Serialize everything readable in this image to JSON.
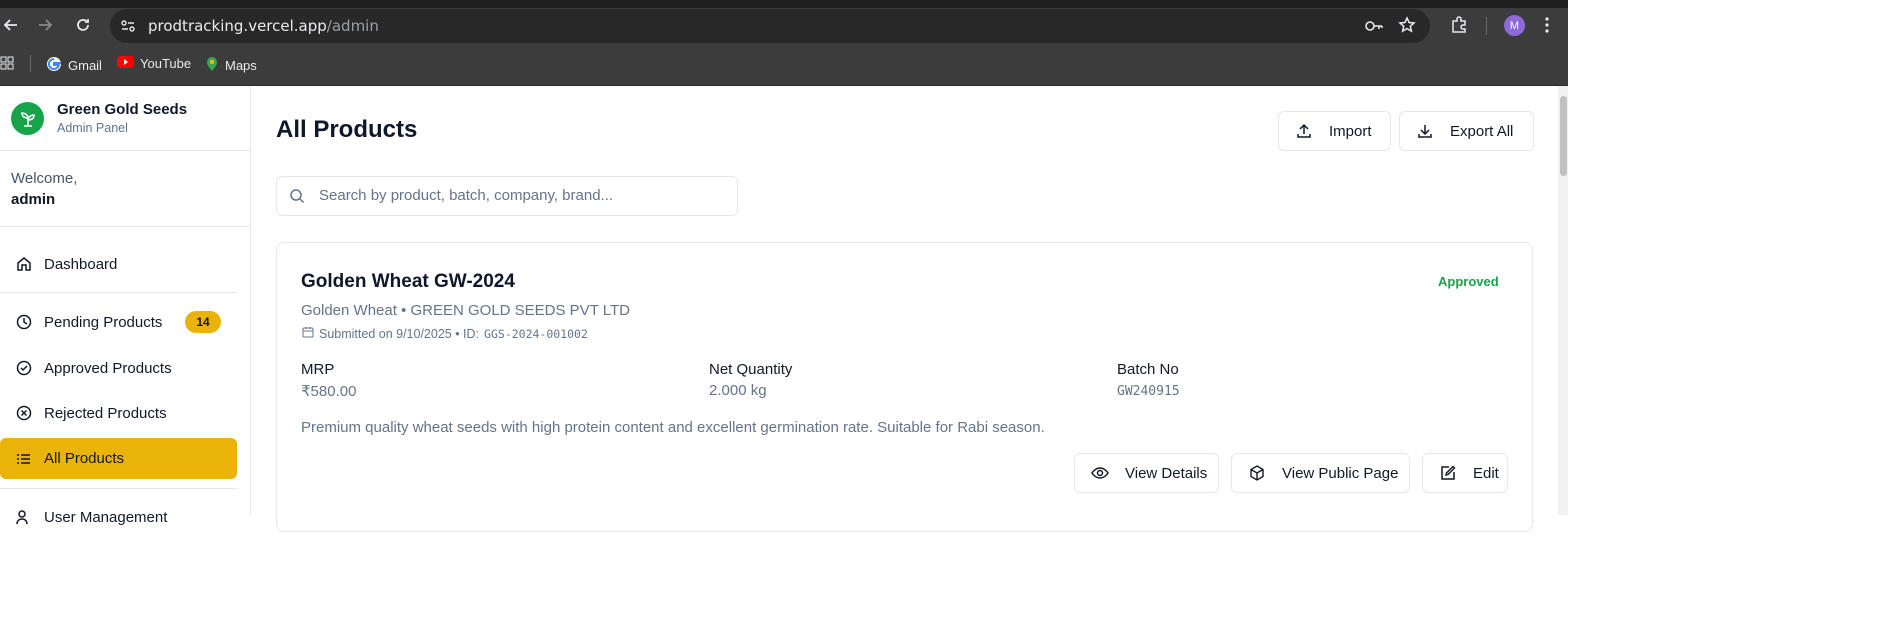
{
  "browser": {
    "url_host": "prodtracking.vercel.app",
    "url_path": "/admin",
    "profile_initial": "M",
    "bookmarks": [
      {
        "label": "Gmail"
      },
      {
        "label": "YouTube"
      },
      {
        "label": "Maps"
      }
    ]
  },
  "sidebar": {
    "brand_name": "Green Gold Seeds",
    "brand_sub": "Admin Panel",
    "welcome": "Welcome,",
    "user": "admin",
    "items": [
      {
        "label": "Dashboard",
        "icon": "home-icon"
      },
      {
        "label": "Pending Products",
        "icon": "clock-icon",
        "badge": "14"
      },
      {
        "label": "Approved Products",
        "icon": "check-circle-icon"
      },
      {
        "label": "Rejected Products",
        "icon": "x-circle-icon"
      },
      {
        "label": "All Products",
        "icon": "list-icon",
        "active": true
      },
      {
        "label": "User Management",
        "icon": "users-icon"
      }
    ]
  },
  "main": {
    "title": "All Products",
    "import_label": "Import",
    "export_label": "Export All",
    "search_placeholder": "Search by product, batch, company, brand..."
  },
  "product": {
    "name": "Golden Wheat GW-2024",
    "status": "Approved",
    "brand_company": "Golden Wheat • GREEN GOLD SEEDS PVT LTD",
    "submitted": "Submitted on 9/10/2025 • ID:",
    "id": "GGS-2024-001002",
    "mrp_label": "MRP",
    "mrp_value": "₹580.00",
    "qty_label": "Net Quantity",
    "qty_value": "2.000 kg",
    "batch_label": "Batch No",
    "batch_value": "GW240915",
    "description": "Premium quality wheat seeds with high protein content and excellent germination rate. Suitable for Rabi season.",
    "view_details_label": "View Details",
    "view_public_label": "View Public Page",
    "edit_label": "Edit"
  },
  "colors": {
    "accent": "#eab308",
    "brand_green": "#16a34a",
    "approved_green": "#16a34a"
  }
}
